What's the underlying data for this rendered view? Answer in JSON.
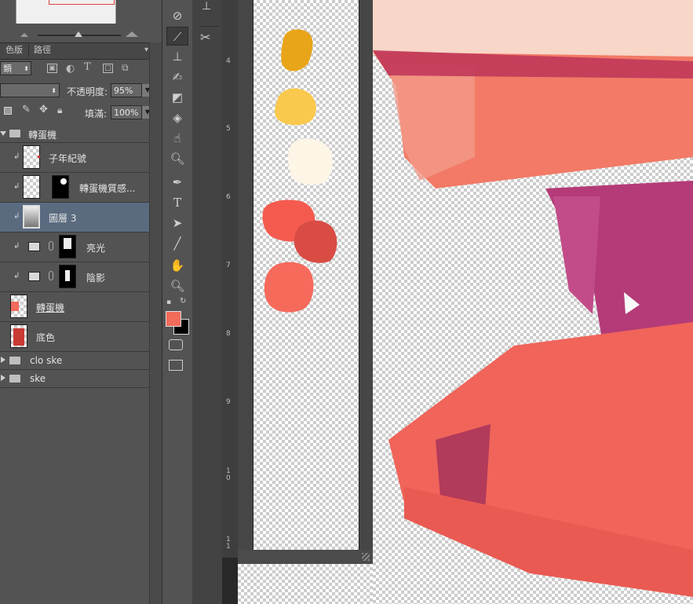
{
  "panel_tabs": [
    "色版",
    "路徑"
  ],
  "layers_panel": {
    "kind_filter_label": "類",
    "blend_mode_value": "",
    "opacity_label": "不透明度:",
    "opacity_value": "95%",
    "fill_label": "填滿:",
    "fill_value": "100%"
  },
  "layers": [
    {
      "name": "轉蛋機",
      "type": "group",
      "expanded": true
    },
    {
      "name": "子年紀號",
      "type": "layer",
      "clipped": true
    },
    {
      "name": "轉蛋機質感...",
      "type": "layer-with-mask",
      "clipped": true
    },
    {
      "name": "圖層 3",
      "type": "layer",
      "clipped": true,
      "selected": true
    },
    {
      "name": "亮光",
      "type": "adjustment",
      "clipped": true
    },
    {
      "name": "陰影",
      "type": "adjustment",
      "clipped": true
    },
    {
      "name": "轉蛋機",
      "type": "layer",
      "underlined": true
    },
    {
      "name": "底色",
      "type": "layer"
    },
    {
      "name": "clo ske",
      "type": "group",
      "expanded": false
    },
    {
      "name": "ske",
      "type": "group",
      "expanded": false
    }
  ],
  "ruler": {
    "labels": [
      "4",
      "5",
      "6",
      "7",
      "8",
      "9",
      "10",
      "11"
    ]
  },
  "colors": {
    "foreground": "#f26b5b",
    "background": "#000000",
    "selection_highlight": "#5a6b80",
    "swatches": [
      "#e8a519",
      "#fac84d",
      "#fdf5e6",
      "#f55a4f",
      "#d84c44",
      "#f66a5c"
    ]
  },
  "tools": [
    "spot-heal-icon",
    "brush-icon",
    "stamp-icon",
    "history-brush-icon",
    "eraser-icon",
    "bucket-icon",
    "blur-icon",
    "dodge-icon",
    "pen-icon",
    "type-icon",
    "path-select-icon",
    "line-icon",
    "hand-icon",
    "zoom-icon"
  ]
}
